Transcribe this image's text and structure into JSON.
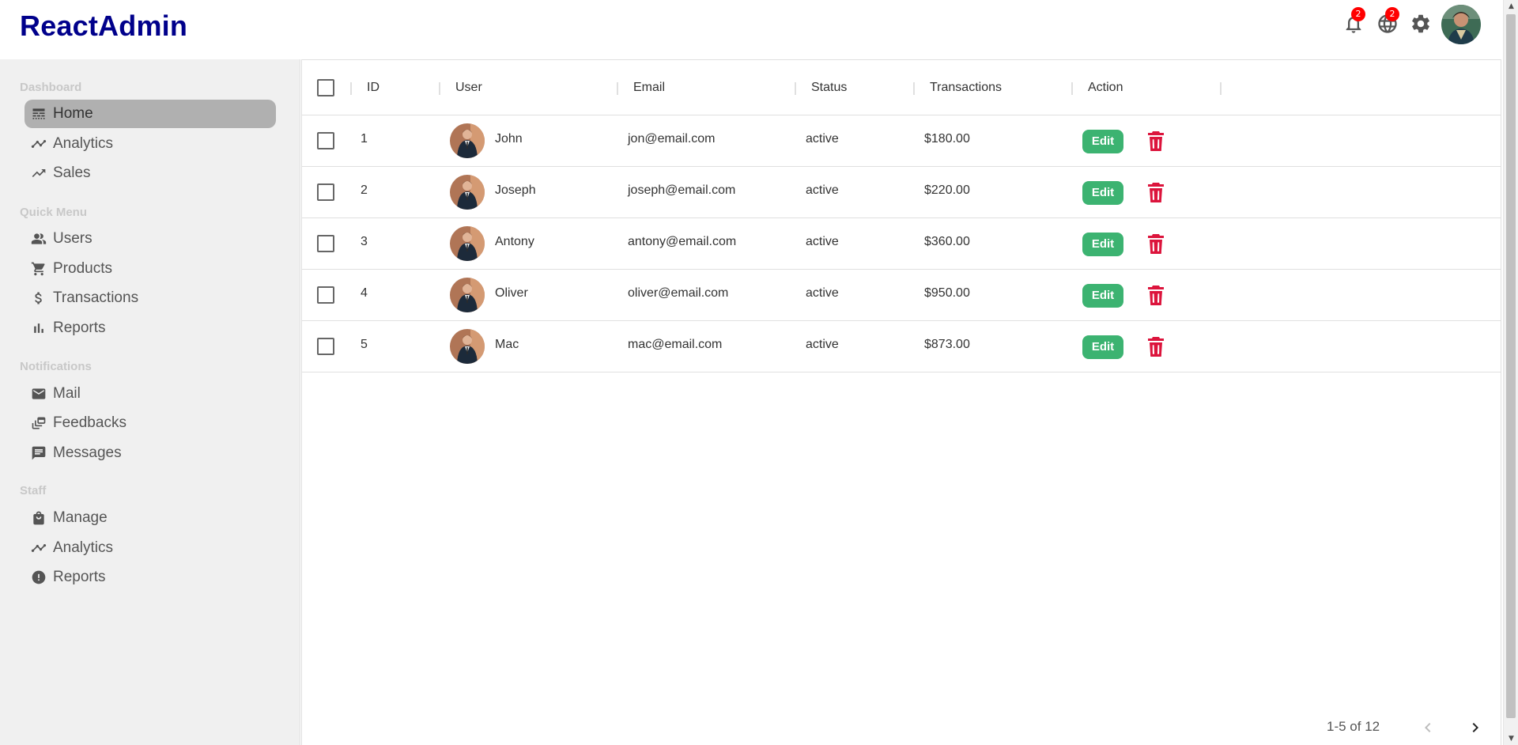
{
  "app": {
    "title": "ReactAdmin"
  },
  "topbar": {
    "notifications_badge": "2",
    "language_badge": "2",
    "icons": [
      "bell-icon",
      "globe-icon",
      "gear-icon",
      "avatar"
    ]
  },
  "sidebar": {
    "sections": [
      {
        "title": "Dashboard",
        "items": [
          {
            "label": "Home",
            "icon": "line-style-icon",
            "active": true
          },
          {
            "label": "Analytics",
            "icon": "timeline-icon"
          },
          {
            "label": "Sales",
            "icon": "trending-up-icon"
          }
        ]
      },
      {
        "title": "Quick Menu",
        "items": [
          {
            "label": "Users",
            "icon": "people-icon"
          },
          {
            "label": "Products",
            "icon": "cart-icon"
          },
          {
            "label": "Transactions",
            "icon": "dollar-icon"
          },
          {
            "label": "Reports",
            "icon": "bar-chart-icon"
          }
        ]
      },
      {
        "title": "Notifications",
        "items": [
          {
            "label": "Mail",
            "icon": "mail-icon"
          },
          {
            "label": "Feedbacks",
            "icon": "dynamic-feed-icon"
          },
          {
            "label": "Messages",
            "icon": "chat-icon"
          }
        ]
      },
      {
        "title": "Staff",
        "items": [
          {
            "label": "Manage",
            "icon": "work-icon"
          },
          {
            "label": "Analytics",
            "icon": "timeline-icon"
          },
          {
            "label": "Reports",
            "icon": "report-icon"
          }
        ]
      }
    ]
  },
  "table": {
    "columns": [
      "ID",
      "User",
      "Email",
      "Status",
      "Transactions",
      "Action"
    ],
    "rows": [
      {
        "id": "1",
        "user": "John",
        "email": "jon@email.com",
        "status": "active",
        "transactions": "$180.00",
        "edit": "Edit"
      },
      {
        "id": "2",
        "user": "Joseph",
        "email": "joseph@email.com",
        "status": "active",
        "transactions": "$220.00",
        "edit": "Edit"
      },
      {
        "id": "3",
        "user": "Antony",
        "email": "antony@email.com",
        "status": "active",
        "transactions": "$360.00",
        "edit": "Edit"
      },
      {
        "id": "4",
        "user": "Oliver",
        "email": "oliver@email.com",
        "status": "active",
        "transactions": "$950.00",
        "edit": "Edit"
      },
      {
        "id": "5",
        "user": "Mac",
        "email": "mac@email.com",
        "status": "active",
        "transactions": "$873.00",
        "edit": "Edit"
      }
    ],
    "pagination": "1-5 of 12"
  },
  "colors": {
    "brand": "#00008b",
    "edit": "#3cb371",
    "delete": "#dc143c",
    "badge": "#ff0000"
  }
}
